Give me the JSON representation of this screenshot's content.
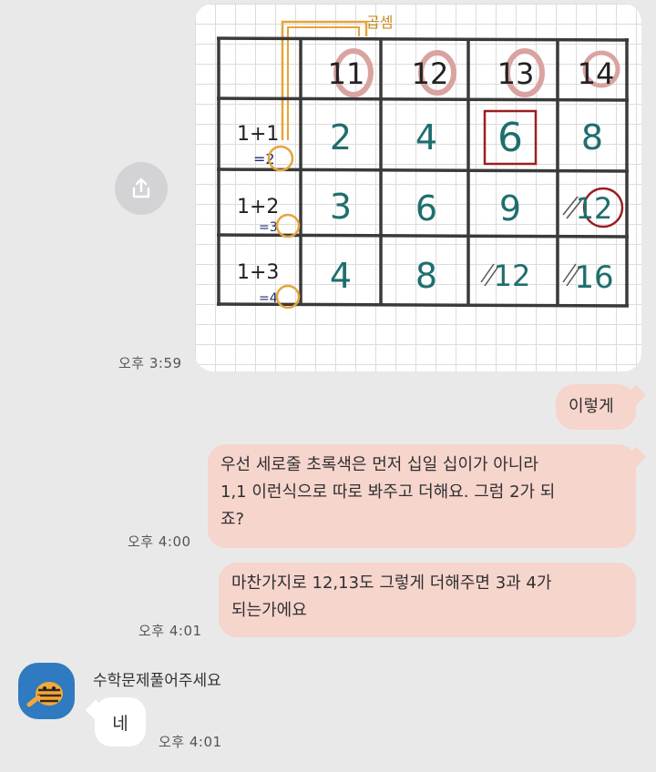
{
  "photo": {
    "annotation": "곱셈",
    "headers": [
      "11",
      "12",
      "13",
      "14"
    ],
    "rows": [
      {
        "label_top": "1+1",
        "label_bottom": "=2",
        "cells": [
          "2",
          "4",
          "6",
          "8"
        ]
      },
      {
        "label_top": "1+2",
        "label_bottom": "=3",
        "cells": [
          "3",
          "6",
          "9",
          "12"
        ]
      },
      {
        "label_top": "1+3",
        "label_bottom": "=4",
        "cells": [
          "4",
          "8",
          "12",
          "16"
        ]
      }
    ]
  },
  "share_icon": "share-icon",
  "messages": [
    {
      "time": "오후 3:59"
    },
    {
      "text": "이렇게"
    },
    {
      "text_lines": [
        "우선 세로줄 초록색은 먼저 십일 십이가 아니라",
        "1,1 이런식으로 따로 봐주고 더해요. 그럼 2가 되",
        "죠?"
      ],
      "time": "오후 4:00"
    },
    {
      "text_lines": [
        "마찬가지로 12,13도  그렇게 더해주면 3과 4가",
        "되는가에요"
      ],
      "time": "오후 4:01"
    }
  ],
  "reply": {
    "sender": "수학문제풀어주세요",
    "text": "네",
    "time": "오후 4:01"
  },
  "colors": {
    "background": "#e9e9ea",
    "my_bubble": "#f6d5cd",
    "other_bubble": "#ffffff",
    "highlight_orange": "#e5a53a",
    "highlight_pink": "#d9a3a0",
    "teal_ink": "#1f6e6e",
    "navy_ink": "#1b2a6b",
    "red_ink": "#9a2020"
  }
}
